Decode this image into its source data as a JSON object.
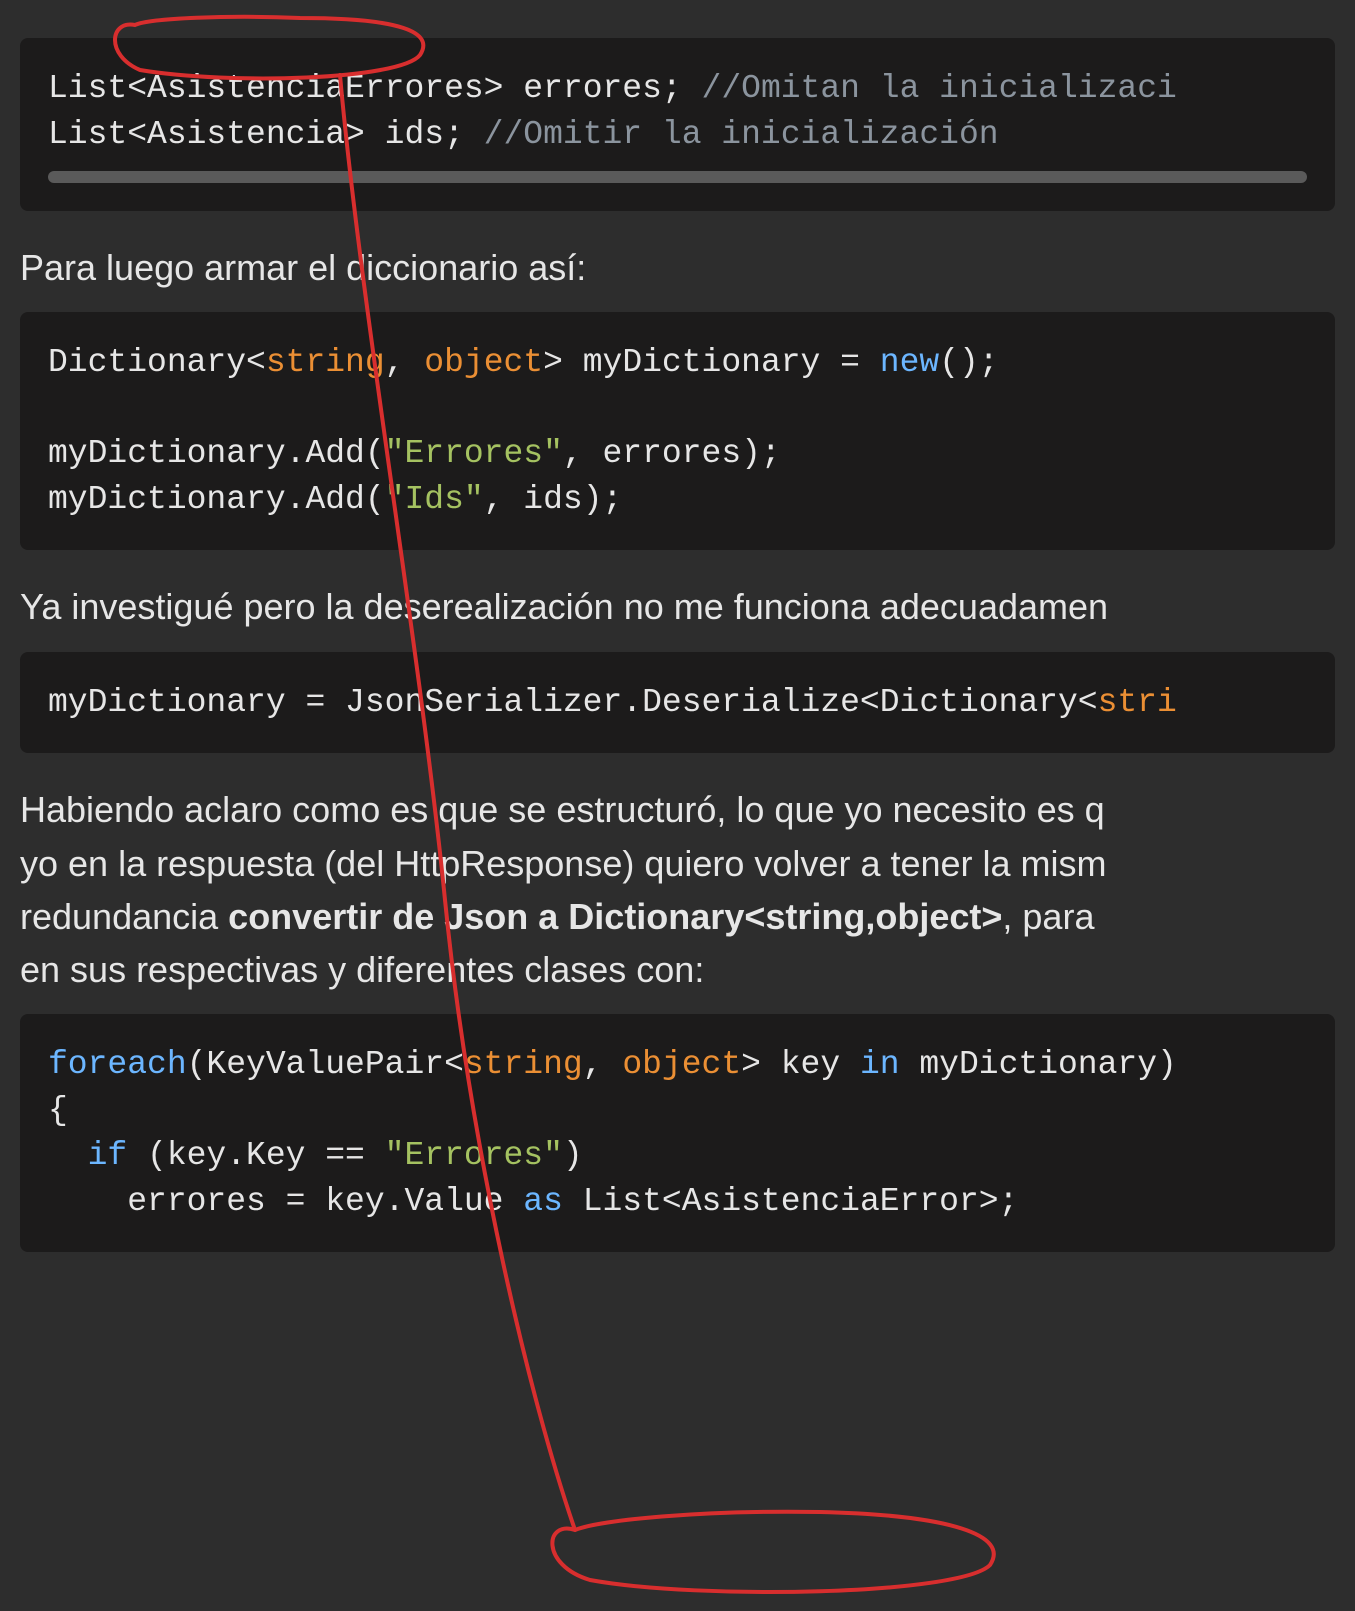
{
  "code1": {
    "l1_a": "List",
    "l1_b": "<AsistenciaErrores>",
    "l1_c": " errores; ",
    "l1_d": "//Omitan la inicializaci",
    "l2_a": "List<Asistencia> ids; ",
    "l2_b": "//Omitir la inicialización"
  },
  "prose1": "Para luego armar el diccionario así:",
  "code2": {
    "l1_a": "Dictionary<",
    "l1_b": "string",
    "l1_c": ", ",
    "l1_d": "object",
    "l1_e": "> myDictionary = ",
    "l1_f": "new",
    "l1_g": "();",
    "l3_a": "myDictionary.Add(",
    "l3_b": "\"Errores\"",
    "l3_c": ", errores);",
    "l4_a": "myDictionary.Add(",
    "l4_b": "\"Ids\"",
    "l4_c": ", ids);"
  },
  "prose2": "Ya investigué pero la deserealización no me funciona adecuadamen",
  "code3": {
    "l1_a": "myDictionary = JsonSerializer.Deserialize<Dictionary<",
    "l1_b": "stri"
  },
  "prose3_a": "Habiendo aclaro como es que se estructuró, lo que yo necesito es q",
  "prose3_b": "yo en la respuesta (del HttpResponse) quiero volver a tener la mism",
  "prose3_c": "redundancia ",
  "prose3_bold": "convertir de Json a Dictionary<string,object>",
  "prose3_d": ", para ",
  "prose3_e": "en sus respectivas y diferentes clases con:",
  "code4": {
    "l1_a": "foreach",
    "l1_b": "(KeyValuePair<",
    "l1_c": "string",
    "l1_d": ", ",
    "l1_e": "object",
    "l1_f": "> key ",
    "l1_g": "in",
    "l1_h": " myDictionary)",
    "l2": "{",
    "l3_a": "  ",
    "l3_b": "if",
    "l3_c": " (key.Key == ",
    "l3_d": "\"Errores\"",
    "l3_e": ")",
    "l4_a": "    errores = key.Value ",
    "l4_b": "as",
    "l4_c": " List<AsistenciaError>;"
  },
  "annotation_color": "#d82e2e"
}
